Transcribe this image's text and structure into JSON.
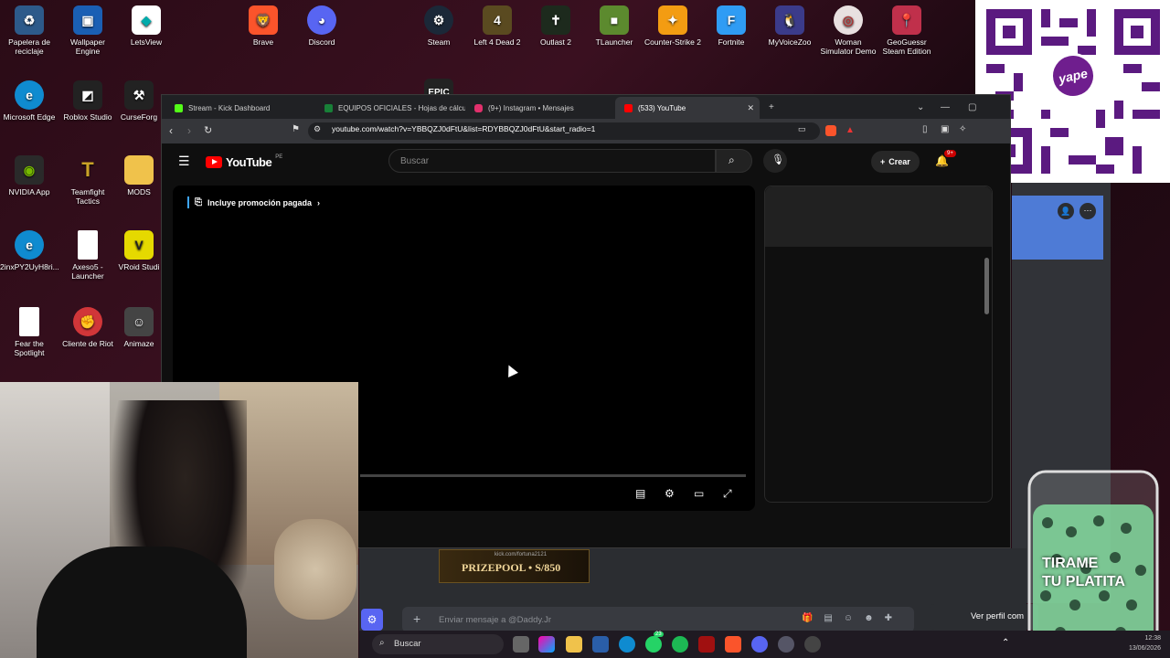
{
  "desktop": {
    "icons": [
      {
        "label": "Papelera de reciclaje",
        "icon": "recycle-bin-icon",
        "color": "#1e90ff"
      },
      {
        "label": "Wallpaper Engine",
        "icon": "wallpaper-engine-icon",
        "color": "#1a5fb4"
      },
      {
        "label": "LetsView",
        "icon": "letsview-icon",
        "color": "#ffffff"
      },
      {
        "label": "Brave",
        "icon": "brave-icon",
        "color": "#fb542b"
      },
      {
        "label": "Discord",
        "icon": "discord-icon",
        "color": "#5865f2"
      },
      {
        "label": "Steam",
        "icon": "steam-icon",
        "color": "#1b2838"
      },
      {
        "label": "Left 4 Dead 2",
        "icon": "left4dead-icon",
        "color": "#5a4a20"
      },
      {
        "label": "Outlast 2",
        "icon": "outlast-icon",
        "color": "#1d2a1d"
      },
      {
        "label": "TLauncher",
        "icon": "tlauncher-icon",
        "color": "#5c8a2e"
      },
      {
        "label": "Counter-Strike 2",
        "icon": "counter-strike-icon",
        "color": "#f39c12"
      },
      {
        "label": "Fortnite",
        "icon": "fortnite-icon",
        "color": "#2f9cf4"
      },
      {
        "label": "MyVoiceZoo",
        "icon": "myvoicezoo-icon",
        "color": "#3b3b8a"
      },
      {
        "label": "Woman Simulator Demo",
        "icon": "woman-simulator-icon",
        "color": "#e8e0e0"
      },
      {
        "label": "GeoGuessr Steam Edition",
        "icon": "geoguessr-icon",
        "color": "#c0304b"
      },
      {
        "label": "Microsoft Edge",
        "icon": "edge-icon",
        "color": "#0f8bd0"
      },
      {
        "label": "Roblox Studio",
        "icon": "roblox-icon",
        "color": "#222222"
      },
      {
        "label": "CurseForg",
        "icon": "curseforge-icon",
        "color": "#222222"
      },
      {
        "label": "NVIDIA App",
        "icon": "nvidia-icon",
        "color": "#2a2a2a"
      },
      {
        "label": "Teamfight Tactics",
        "icon": "tft-icon",
        "color": "#c9a227"
      },
      {
        "label": "MODS",
        "icon": "folder-icon",
        "color": "#f0c24b"
      },
      {
        "label": "2inxPY2UyH8ri...",
        "icon": "edge-shortcut-icon",
        "color": "#0f8bd0"
      },
      {
        "label": "Axeso5 - Launcher",
        "icon": "file-icon",
        "color": "#ffffff"
      },
      {
        "label": "VRoid Studi",
        "icon": "vroid-icon",
        "color": "#e5d900"
      },
      {
        "label": "Fear the Spotlight",
        "icon": "file-icon",
        "color": "#ffffff"
      },
      {
        "label": "Cliente de Riot",
        "icon": "riot-icon",
        "color": "#d13639"
      },
      {
        "label": "Animaze",
        "icon": "animaze-icon",
        "color": "#444444"
      },
      {
        "label": "EPIC",
        "icon": "epic-games-icon",
        "color": "#222222"
      }
    ]
  },
  "browser": {
    "tabs": [
      {
        "label": "Stream - Kick Dashboard",
        "favicon_color": "#53fc18",
        "active": false
      },
      {
        "label": "EQUIPOS OFICIALES - Hojas de cálcu",
        "favicon_color": "#188038",
        "active": false
      },
      {
        "label": "(9+) Instagram • Mensajes",
        "favicon_color": "#e1306c",
        "active": false
      },
      {
        "label": "(533) YouTube",
        "favicon_color": "#ff0000",
        "active": true
      }
    ],
    "url": "youtube.com/watch?v=YBBQZJ0dFtU&list=RDYBBQZJ0dFtU&start_radio=1",
    "brave_shield_count": "18"
  },
  "youtube": {
    "logo_text": "YouTube",
    "country_code": "PE",
    "search_placeholder": "Buscar",
    "create_label": "Crear",
    "notification_badge": "9+",
    "paid_promo_label": "Incluye promoción pagada"
  },
  "discord": {
    "message_placeholder": "Enviar mensaje a @Daddy.Jr",
    "view_profile_label": "Ver perfil com",
    "banner_small": "kick.com/fortuna2121",
    "banner_big": "PRIZEPOOL • S/850"
  },
  "overlay": {
    "jar_text_line1": "TIRAME",
    "jar_text_line2": "TU PLATITA",
    "qr_brand": "yape"
  },
  "taskbar": {
    "search_label": "Buscar",
    "whatsapp_badge": "23",
    "time": "12:38",
    "date": "13/06/2026"
  }
}
